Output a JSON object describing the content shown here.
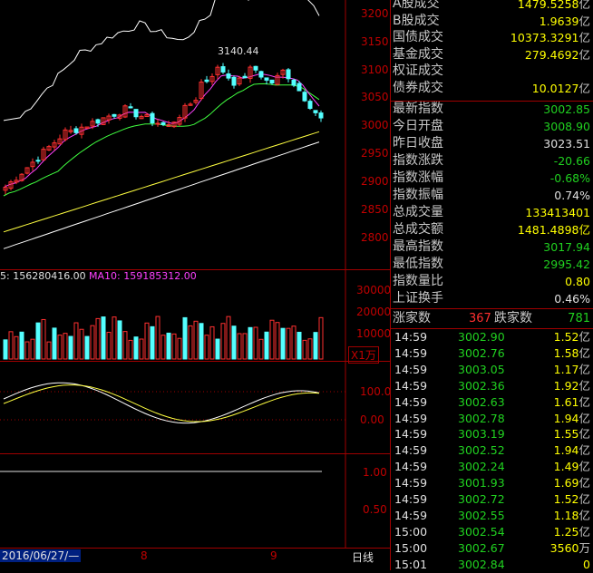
{
  "chart": {
    "price_ticks": [
      "3200",
      "3150",
      "3100",
      "3050",
      "3000",
      "2950",
      "2900",
      "2850",
      "2800"
    ],
    "peak_label": "3140.44",
    "volume_label": "5: 156280416.00",
    "ma10_label": "MA10: 159185312.00",
    "volume_ticks": [
      "30000",
      "20000",
      "10000"
    ],
    "volume_unit": "X1万",
    "indicator_ticks": [
      "100.0",
      "0.00"
    ],
    "ratio_ticks": [
      "1.00",
      "0.50"
    ],
    "date_start": "2016/06/27/—",
    "month_labels": [
      "8",
      "9"
    ],
    "period_label": "日线"
  },
  "summary": [
    {
      "label": "A股成交",
      "value": "1479.5258",
      "unit": "亿"
    },
    {
      "label": "B股成交",
      "value": "1.9639",
      "unit": "亿"
    },
    {
      "label": "国债成交",
      "value": "10373.3291",
      "unit": "亿"
    },
    {
      "label": "基金成交",
      "value": "279.4692",
      "unit": "亿"
    },
    {
      "label": "权证成交",
      "value": "",
      "unit": ""
    },
    {
      "label": "债券成交",
      "value": "10.0127",
      "unit": "亿"
    }
  ],
  "quote": [
    {
      "label": "最新指数",
      "value": "3002.85",
      "color": "#20d020"
    },
    {
      "label": "今日开盘",
      "value": "3008.90",
      "color": "#20d020"
    },
    {
      "label": "昨日收盘",
      "value": "3023.51",
      "color": "#e0e0e0"
    },
    {
      "label": "指数涨跌",
      "value": "-20.66",
      "color": "#20d020"
    },
    {
      "label": "指数涨幅",
      "value": "-0.68%",
      "color": "#20d020"
    },
    {
      "label": "指数振幅",
      "value": "0.74%",
      "color": "#e0e0e0"
    },
    {
      "label": "总成交量",
      "value": "133413401",
      "color": "#ffff00"
    },
    {
      "label": "总成交额",
      "value": "1481.4898亿",
      "color": "#ffff00"
    },
    {
      "label": "最高指数",
      "value": "3017.94",
      "color": "#20d020"
    },
    {
      "label": "最低指数",
      "value": "2995.42",
      "color": "#20d020"
    },
    {
      "label": "指数量比",
      "value": "0.80",
      "color": "#ffff00"
    },
    {
      "label": "上证换手",
      "value": "0.46%",
      "color": "#e0e0e0"
    }
  ],
  "breadth": {
    "up_label": "涨家数",
    "up_count": "367",
    "down_label": "跌家数",
    "down_count": "781"
  },
  "ticks": [
    {
      "time": "14:59",
      "price": "3002.90",
      "vol": "1.52",
      "unit": "亿"
    },
    {
      "time": "14:59",
      "price": "3002.76",
      "vol": "1.58",
      "unit": "亿"
    },
    {
      "time": "14:59",
      "price": "3003.05",
      "vol": "1.17",
      "unit": "亿"
    },
    {
      "time": "14:59",
      "price": "3002.36",
      "vol": "1.92",
      "unit": "亿"
    },
    {
      "time": "14:59",
      "price": "3002.63",
      "vol": "1.61",
      "unit": "亿"
    },
    {
      "time": "14:59",
      "price": "3002.78",
      "vol": "1.94",
      "unit": "亿"
    },
    {
      "time": "14:59",
      "price": "3003.19",
      "vol": "1.55",
      "unit": "亿"
    },
    {
      "time": "14:59",
      "price": "3002.52",
      "vol": "1.94",
      "unit": "亿"
    },
    {
      "time": "14:59",
      "price": "3002.24",
      "vol": "1.49",
      "unit": "亿"
    },
    {
      "time": "14:59",
      "price": "3001.93",
      "vol": "1.69",
      "unit": "亿"
    },
    {
      "time": "14:59",
      "price": "3002.72",
      "vol": "1.52",
      "unit": "亿"
    },
    {
      "time": "14:59",
      "price": "3002.55",
      "vol": "1.18",
      "unit": "亿"
    },
    {
      "time": "15:00",
      "price": "3002.54",
      "vol": "1.25",
      "unit": "亿"
    },
    {
      "time": "15:00",
      "price": "3002.67",
      "vol": "3560",
      "unit": "万"
    },
    {
      "time": "15:01",
      "price": "3002.84",
      "vol": "0",
      "unit": ""
    }
  ]
}
